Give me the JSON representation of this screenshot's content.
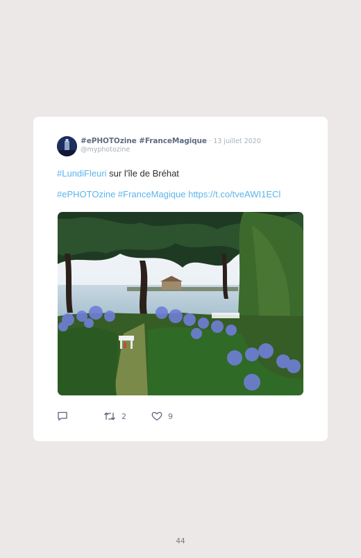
{
  "tweet": {
    "display_name": "#ePHOTOzine #FranceMagique",
    "date": "· 13 juillet 2020",
    "handle": "@myphotozine",
    "line1_hashtag": "#LundiFleuri",
    "line1_text": " sur l'île de Bréhat",
    "line2_hashtags": "#ePHOTOzine #FranceMagique",
    "line2_link": "https://t.co/tveAWI1ECl",
    "photo_icon": "landscape-photo"
  },
  "actions": {
    "reply_icon": "reply-icon",
    "retweet_count": "2",
    "like_count": "9"
  },
  "page_number": "44",
  "colors": {
    "background": "#ede8e8",
    "card": "#ffffff",
    "link": "#5bb4ea",
    "name": "#5d6a82",
    "muted": "#a6aebb"
  }
}
